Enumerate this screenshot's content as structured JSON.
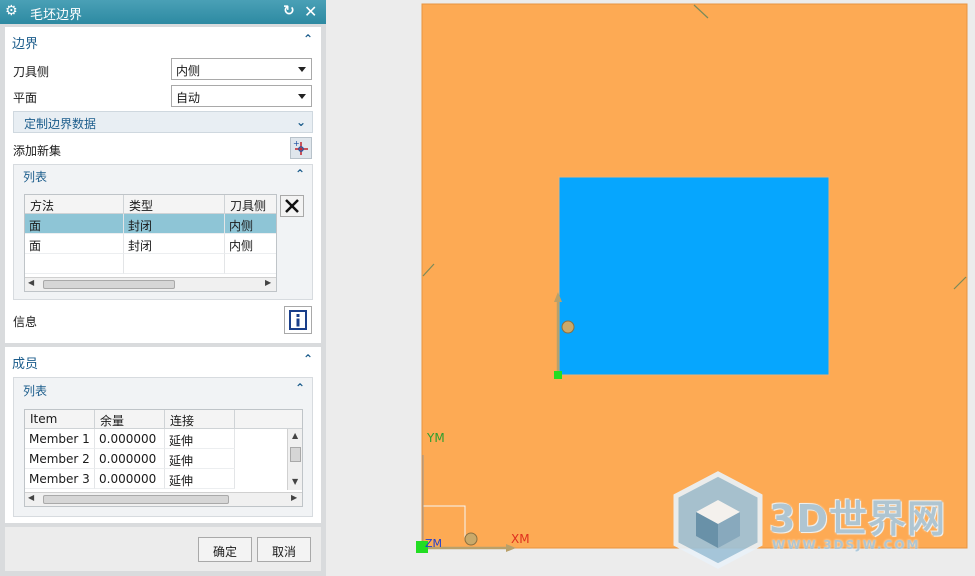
{
  "dialog": {
    "title": "毛坯边界",
    "boundary": {
      "header": "边界",
      "tool_side_label": "刀具侧",
      "tool_side_value": "内侧",
      "plane_label": "平面",
      "plane_value": "自动",
      "custom_data_label": "定制边界数据",
      "add_new_set_label": "添加新集"
    },
    "list1": {
      "header": "列表",
      "columns": [
        "方法",
        "类型",
        "刀具侧"
      ],
      "rows": [
        {
          "c1": "面",
          "c2": "封闭",
          "c3": "内侧"
        },
        {
          "c1": "面",
          "c2": "封闭",
          "c3": "内侧"
        }
      ]
    },
    "info_label": "信息",
    "members": {
      "header": "成员",
      "list_header": "列表",
      "columns": [
        "Item",
        "余量",
        "连接"
      ],
      "rows": [
        {
          "c1": "Member 1",
          "c2": "0.000000",
          "c3": "延伸"
        },
        {
          "c1": "Member 2",
          "c2": "0.000000",
          "c3": "延伸"
        },
        {
          "c1": "Member 3",
          "c2": "0.000000",
          "c3": "延伸"
        }
      ]
    },
    "ok_label": "确定",
    "cancel_label": "取消"
  },
  "viewport": {
    "ym_label": "YM",
    "xm_label": "XM",
    "zm_label": "ZM",
    "watermark_text": "3D世界网",
    "watermark_url": "WWW.3DSJW.COM"
  },
  "colors": {
    "title_bar": "#3592aa",
    "section_header": "#1c5d8c",
    "selected_row": "#8ec5d6",
    "stock_orange": "#fdaa54",
    "part_blue": "#06a6fe",
    "ym_green": "#2e9e2e",
    "xm_red": "#e0301e"
  },
  "icons": [
    "gear-icon",
    "reset-icon",
    "close-icon",
    "chevron-up-icon",
    "chevron-down-icon",
    "add-set-icon",
    "delete-icon",
    "info-icon"
  ]
}
